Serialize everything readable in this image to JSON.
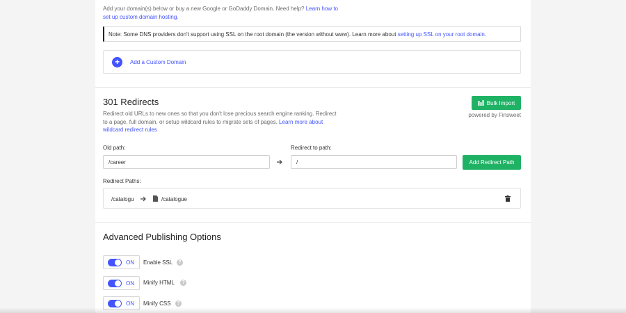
{
  "domains": {
    "intro": "Add your domain(s) below or buy a new Google or GoDaddy Domain. Need help?",
    "intro_link": "Learn how to set up custom domain hosting.",
    "intro_link_part1": "Learn how to",
    "intro_link_part2": "set up custom domain hosting.",
    "note_text": "Note: Some DNS providers don't support using SSL on the root domain (the version without www). Learn more about",
    "note_link": "setting up SSL on your root domain.",
    "add_domain_label": "Add a Custom Domain",
    "plus_symbol": "+"
  },
  "redirects": {
    "title": "301 Redirects",
    "desc_line1": "Redirect old URLs to new ones so that you don't lose precious search engine ranking. Redirect",
    "desc_line2": "to a page, full domain, or setup wildcard rules to migrate sets of pages.",
    "desc_link_part1": "Learn more about",
    "desc_link_part2": "wildcard redirect rules",
    "bulk_import_label": "Bulk Import",
    "powered_by": "powered by Finsweet",
    "old_path_label": "Old path:",
    "old_path_value": "/career",
    "redirect_to_label": "Redirect to path:",
    "redirect_to_value": "/",
    "add_button_label": "Add Redirect Path",
    "paths_label": "Redirect Paths:",
    "paths": [
      {
        "from": "/catalogu",
        "to": "/catalogue"
      }
    ]
  },
  "advanced": {
    "title": "Advanced Publishing Options",
    "options": [
      {
        "state": "ON",
        "label": "Enable SSL"
      },
      {
        "state": "ON",
        "label": "Minify HTML"
      },
      {
        "state": "ON",
        "label": "Minify CSS"
      }
    ]
  },
  "colors": {
    "accent": "#4353ff",
    "green": "#1fb265"
  },
  "icons": [
    "plus-icon",
    "bulk-import-icon",
    "arrow-right-icon",
    "page-icon",
    "trash-icon",
    "help-icon"
  ]
}
